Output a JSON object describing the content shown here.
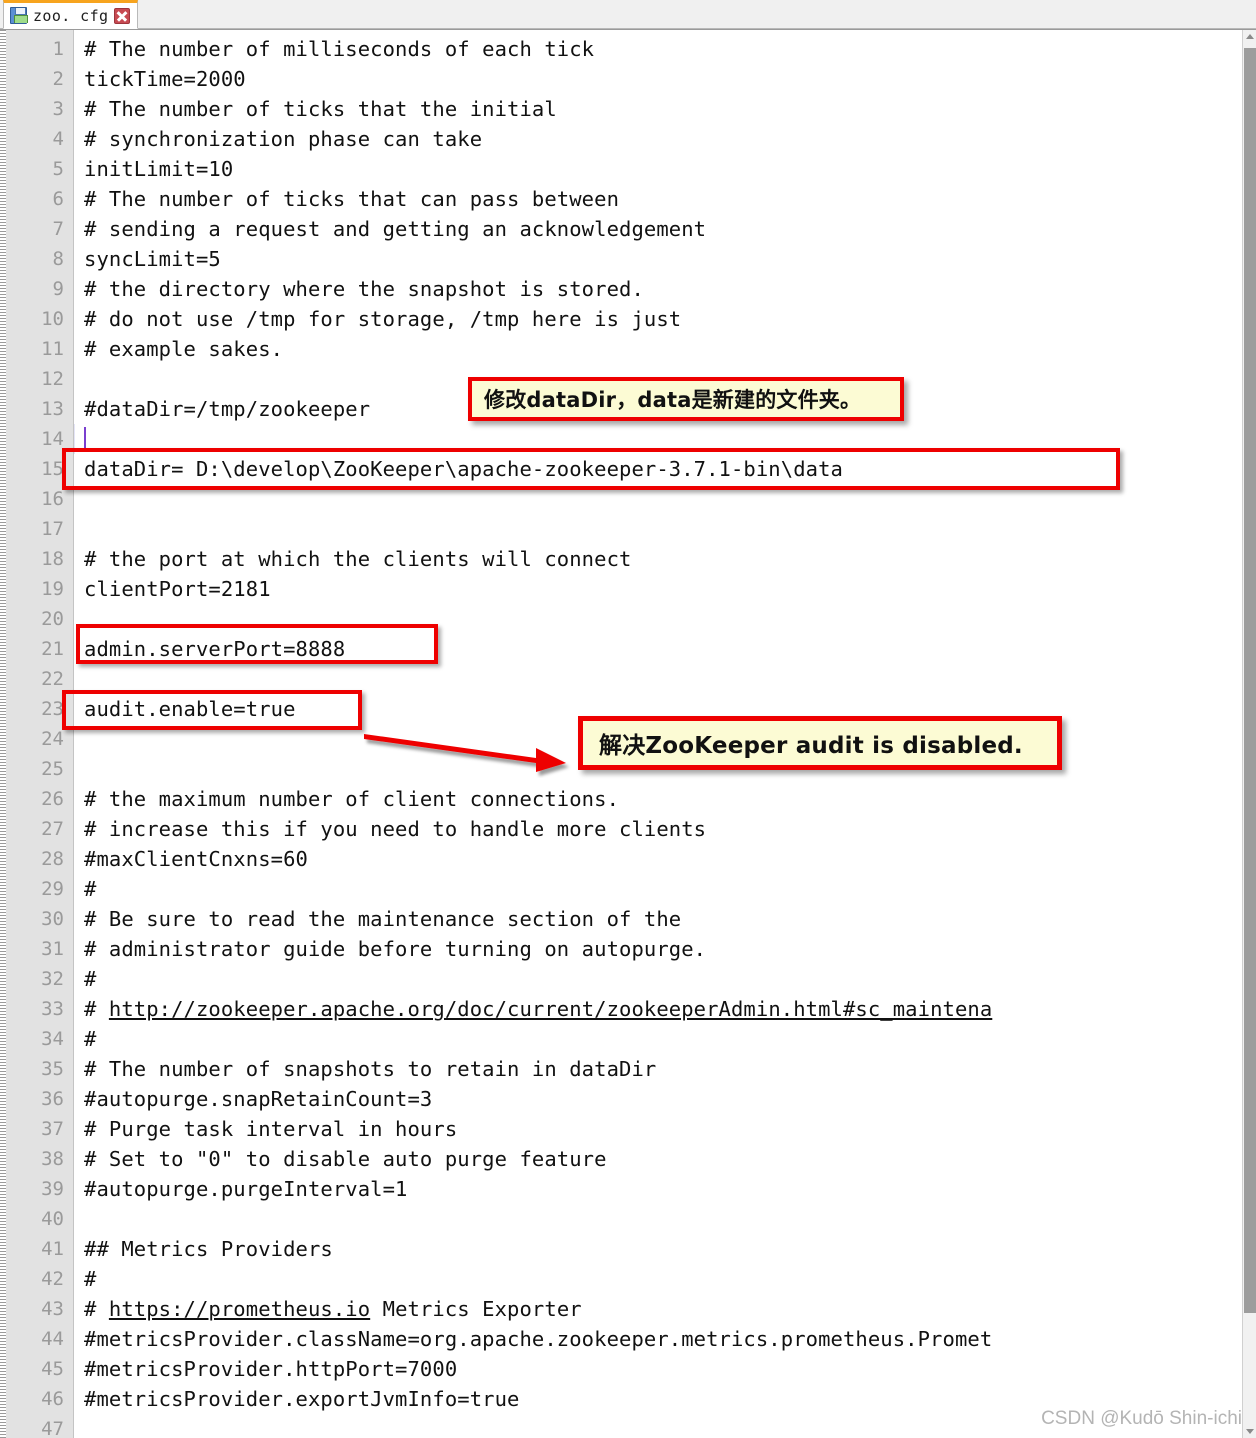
{
  "window": {
    "tab": {
      "label": "zoo. cfg",
      "save_icon": "save-disk-icon",
      "close_icon": "close-icon",
      "accent_color": "#f7a41e"
    }
  },
  "editor": {
    "font": "monospace",
    "first_line_number": 1,
    "current_line": 14,
    "gutter_bg": "#e2e2e2",
    "current_line_bg": "#e4e4f6",
    "caret_color": "#7a3fcf",
    "lines": [
      {
        "n": 1,
        "text": "# The number of milliseconds of each tick"
      },
      {
        "n": 2,
        "text": "tickTime=2000"
      },
      {
        "n": 3,
        "text": "# The number of ticks that the initial"
      },
      {
        "n": 4,
        "text": "# synchronization phase can take"
      },
      {
        "n": 5,
        "text": "initLimit=10"
      },
      {
        "n": 6,
        "text": "# The number of ticks that can pass between"
      },
      {
        "n": 7,
        "text": "# sending a request and getting an acknowledgement"
      },
      {
        "n": 8,
        "text": "syncLimit=5"
      },
      {
        "n": 9,
        "text": "# the directory where the snapshot is stored."
      },
      {
        "n": 10,
        "text": "# do not use /tmp for storage, /tmp here is just"
      },
      {
        "n": 11,
        "text": "# example sakes."
      },
      {
        "n": 12,
        "text": ""
      },
      {
        "n": 13,
        "text": "#dataDir=/tmp/zookeeper"
      },
      {
        "n": 14,
        "text": ""
      },
      {
        "n": 15,
        "text": "dataDir= D:\\develop\\ZooKeeper\\apache-zookeeper-3.7.1-bin\\data"
      },
      {
        "n": 16,
        "text": ""
      },
      {
        "n": 17,
        "text": ""
      },
      {
        "n": 18,
        "text": "# the port at which the clients will connect"
      },
      {
        "n": 19,
        "text": "clientPort=2181"
      },
      {
        "n": 20,
        "text": ""
      },
      {
        "n": 21,
        "text": "admin.serverPort=8888"
      },
      {
        "n": 22,
        "text": ""
      },
      {
        "n": 23,
        "text": "audit.enable=true"
      },
      {
        "n": 24,
        "text": ""
      },
      {
        "n": 25,
        "text": ""
      },
      {
        "n": 26,
        "text": "# the maximum number of client connections."
      },
      {
        "n": 27,
        "text": "# increase this if you need to handle more clients"
      },
      {
        "n": 28,
        "text": "#maxClientCnxns=60"
      },
      {
        "n": 29,
        "text": "#"
      },
      {
        "n": 30,
        "text": "# Be sure to read the maintenance section of the"
      },
      {
        "n": 31,
        "text": "# administrator guide before turning on autopurge."
      },
      {
        "n": 32,
        "text": "#"
      },
      {
        "n": 33,
        "text": "# ",
        "link": "http://zookeeper.apache.org/doc/current/zookeeperAdmin.html#sc_maintena"
      },
      {
        "n": 34,
        "text": "#"
      },
      {
        "n": 35,
        "text": "# The number of snapshots to retain in dataDir"
      },
      {
        "n": 36,
        "text": "#autopurge.snapRetainCount=3"
      },
      {
        "n": 37,
        "text": "# Purge task interval in hours"
      },
      {
        "n": 38,
        "text": "# Set to \"0\" to disable auto purge feature"
      },
      {
        "n": 39,
        "text": "#autopurge.purgeInterval=1"
      },
      {
        "n": 40,
        "text": ""
      },
      {
        "n": 41,
        "text": "## Metrics Providers"
      },
      {
        "n": 42,
        "text": "#"
      },
      {
        "n": 43,
        "text": "# ",
        "link": "https://prometheus.io",
        "after": " Metrics Exporter"
      },
      {
        "n": 44,
        "text": "#metricsProvider.className=org.apache.zookeeper.metrics.prometheus.Promet"
      },
      {
        "n": 45,
        "text": "#metricsProvider.httpPort=7000"
      },
      {
        "n": 46,
        "text": "#metricsProvider.exportJvmInfo=true"
      },
      {
        "n": 47,
        "text": ""
      }
    ]
  },
  "annotations": {
    "callouts": [
      {
        "id": "callout-datadir",
        "text": "修改dataDir，data是新建的文件夹。"
      },
      {
        "id": "callout-audit",
        "text": "解决ZooKeeper audit is disabled."
      }
    ],
    "highlight_boxes": [
      {
        "id": "box-datadir-line",
        "target_line": 15
      },
      {
        "id": "box-admin-serverport",
        "target_line": 21
      },
      {
        "id": "box-audit-enable",
        "target_line": 23
      }
    ],
    "arrow": {
      "id": "arrow-audit",
      "color": "#ee0000",
      "from_line": 23,
      "to": "callout-audit"
    },
    "border_color": "#ee0000",
    "fill_color": "#fcfbd4"
  },
  "watermark": {
    "text": "CSDN @Kudō Shin-ichi"
  }
}
